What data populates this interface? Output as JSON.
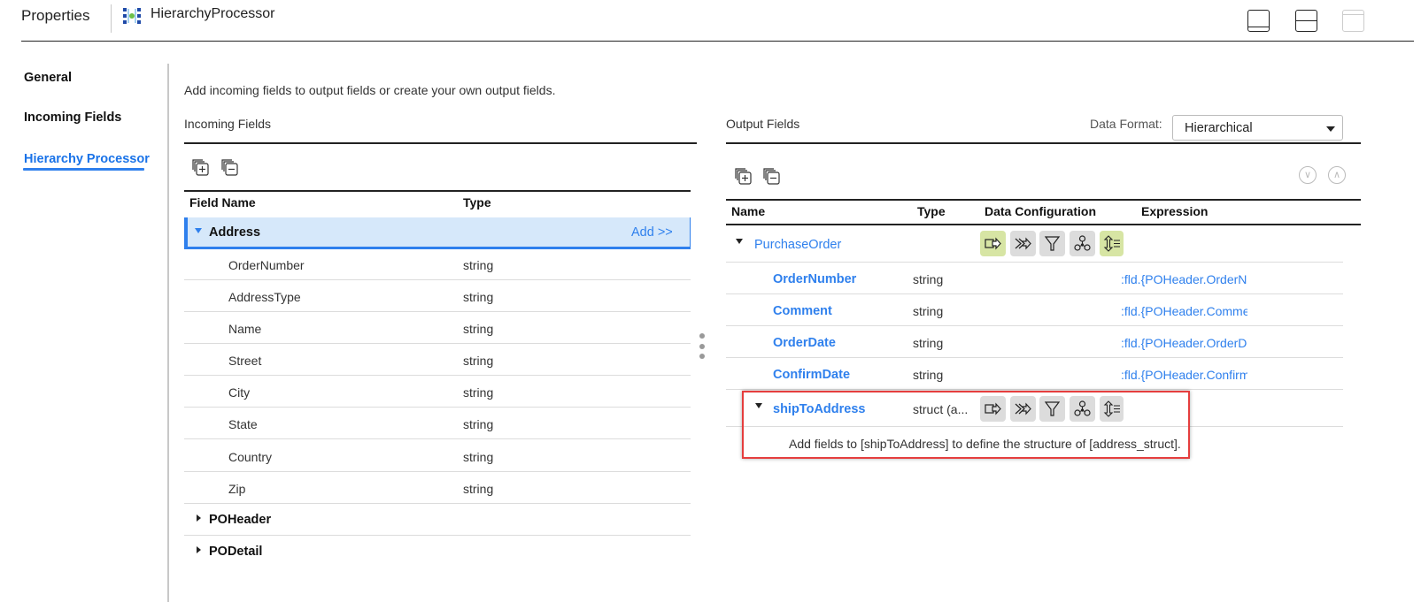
{
  "header": {
    "title": "Properties",
    "processor_name": "HierarchyProcessor",
    "processor_icon": "hierarchy-processor-icon",
    "layout_buttons": [
      {
        "name": "layout-bottom-panel-icon"
      },
      {
        "name": "layout-split-icon"
      },
      {
        "name": "layout-top-panel-icon",
        "disabled": true
      }
    ]
  },
  "nav": {
    "items": [
      {
        "label": "General",
        "active": false
      },
      {
        "label": "Incoming Fields",
        "active": false
      },
      {
        "label": "Hierarchy Processor",
        "active": true
      }
    ]
  },
  "intro_text": "Add incoming fields to output fields or create your own output fields.",
  "incoming": {
    "title": "Incoming Fields",
    "toolbar": {
      "expand_all_icon": "expand-all-icon",
      "collapse_all_icon": "collapse-all-icon"
    },
    "columns": [
      "Field Name",
      "Type"
    ],
    "groups": [
      {
        "name": "Address",
        "expanded": true,
        "selected": true,
        "action_label": "Add >>",
        "fields": [
          {
            "name": "OrderNumber",
            "type": "string"
          },
          {
            "name": "AddressType",
            "type": "string"
          },
          {
            "name": "Name",
            "type": "string"
          },
          {
            "name": "Street",
            "type": "string"
          },
          {
            "name": "City",
            "type": "string"
          },
          {
            "name": "State",
            "type": "string"
          },
          {
            "name": "Country",
            "type": "string"
          },
          {
            "name": "Zip",
            "type": "string"
          }
        ]
      },
      {
        "name": "POHeader",
        "expanded": false
      },
      {
        "name": "PODetail",
        "expanded": false
      }
    ]
  },
  "output": {
    "title": "Output Fields",
    "data_format_label": "Data Format:",
    "data_format_value": "Hierarchical",
    "toolbar": {
      "expand_all_icon": "expand-all-icon",
      "collapse_all_icon": "collapse-all-icon",
      "move_down_icon": "move-down-icon",
      "move_up_icon": "move-up-icon"
    },
    "columns": [
      "Name",
      "Type",
      "Data Configuration",
      "Expression"
    ],
    "config_icons": [
      "input-field-icon",
      "join-icon",
      "filter-icon",
      "hierarchy-node-icon",
      "sort-icon"
    ],
    "rows": [
      {
        "name": "PurchaseOrder",
        "type": "",
        "expanded": true,
        "config_active": [
          true,
          false,
          false,
          false,
          true
        ]
      },
      {
        "name": "OrderNumber",
        "type": "string",
        "expression": ":fld.{POHeader.OrderNumber}"
      },
      {
        "name": "Comment",
        "type": "string",
        "expression": ":fld.{POHeader.Comment}"
      },
      {
        "name": "OrderDate",
        "type": "string",
        "expression": ":fld.{POHeader.OrderDate}"
      },
      {
        "name": "ConfirmDate",
        "type": "string",
        "expression": ":fld.{POHeader.ConfirmDate}"
      },
      {
        "name": "shipToAddress",
        "type": "struct (a...",
        "expanded": true,
        "config_active": [
          false,
          false,
          false,
          false,
          false
        ]
      }
    ],
    "hint": "Add fields to [shipToAddress] to define the structure of [address_struct]."
  },
  "colors": {
    "accent": "#2f80ed",
    "selected_row": "#d6e8fa",
    "config_active": "#d7e5a4",
    "highlight_border": "#e53e3e"
  }
}
